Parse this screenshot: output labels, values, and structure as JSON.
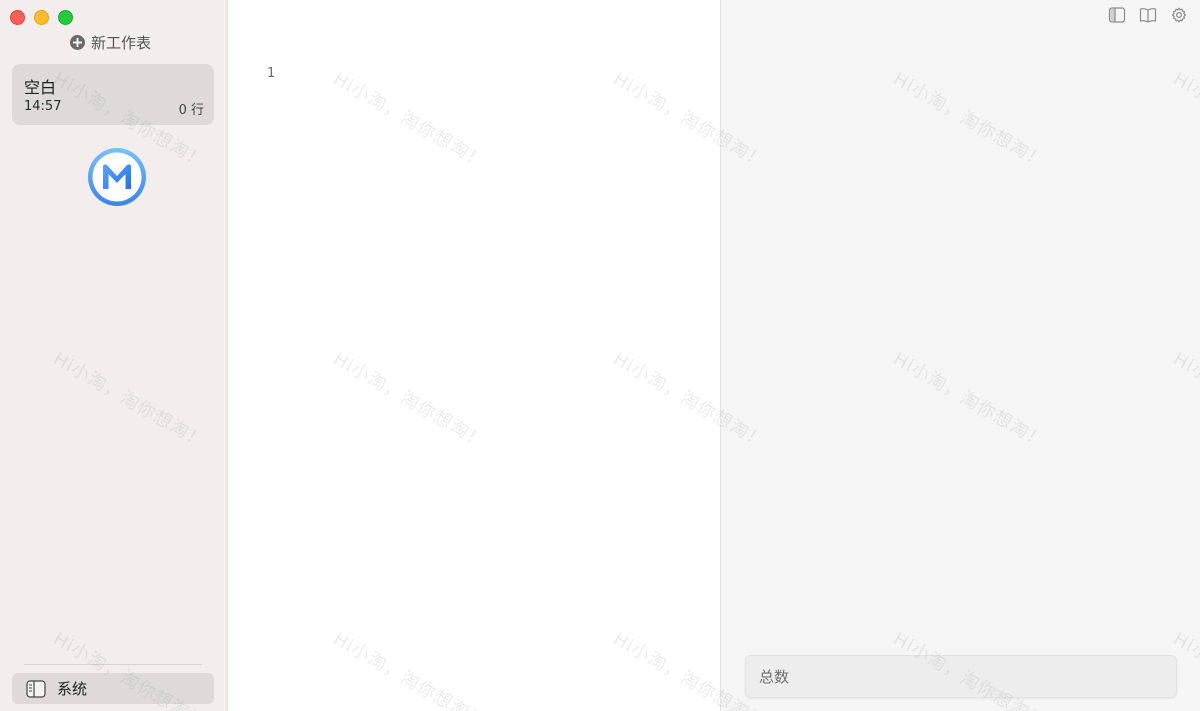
{
  "sidebar": {
    "new_sheet_label": "新工作表",
    "sheets": [
      {
        "title": "空白",
        "time": "14:57",
        "rows": "0 行"
      }
    ],
    "footer_item": {
      "label": "系统"
    }
  },
  "editor": {
    "line_numbers": [
      "1"
    ]
  },
  "results": {
    "total_label": "总数"
  },
  "watermark": {
    "text": "Hi小淘，淘你想淘！"
  },
  "colors": {
    "close": "#ff5f57",
    "minimize": "#febc2e",
    "zoom": "#28c840",
    "logo_accent": "#4a8ff0"
  },
  "icons": {
    "new_sheet": "plus-circle-icon",
    "app_logo": "m-logo-icon",
    "system": "book-icon",
    "toggle_sidebar": "sidebar-icon",
    "docs": "open-book-icon",
    "settings": "gear-icon"
  }
}
